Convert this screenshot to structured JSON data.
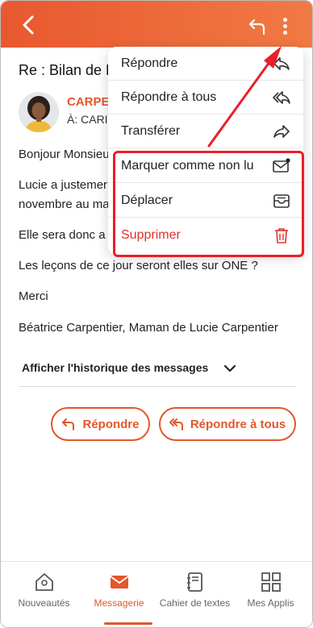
{
  "email": {
    "subject": "Re : Bilan de L",
    "sender_name": "CARPE",
    "sender_to": "À: CARI",
    "paragraphs": [
      "Bonjour Monsieu",
      "Lucie a justemer\nnovembre au ma",
      "Elle sera donc a",
      "Les leçons de ce jour seront elles sur ONE ?",
      "Merci",
      "Béatrice Carpentier, Maman de Lucie Carpentier"
    ],
    "history_label": "Afficher l'historique des messages"
  },
  "actions": {
    "reply": "Répondre",
    "reply_all": "Répondre à tous"
  },
  "menu": {
    "items": [
      {
        "label": "Répondre",
        "icon": "reply-icon"
      },
      {
        "label": "Répondre à tous",
        "icon": "reply-all-icon"
      },
      {
        "label": "Transférer",
        "icon": "forward-icon"
      },
      {
        "label": "Marquer comme non lu",
        "icon": "mail-unread-icon"
      },
      {
        "label": "Déplacer",
        "icon": "archive-tray-icon"
      },
      {
        "label": "Supprimer",
        "icon": "trash-icon"
      }
    ]
  },
  "bottom_nav": {
    "items": [
      {
        "label": "Nouveautés",
        "icon": "home-icon",
        "active": false
      },
      {
        "label": "Messagerie",
        "icon": "mail-icon",
        "active": true
      },
      {
        "label": "Cahier de textes",
        "icon": "notebook-icon",
        "active": false
      },
      {
        "label": "Mes Applis",
        "icon": "apps-grid-icon",
        "active": false
      }
    ]
  },
  "colors": {
    "brand": "#e2572b",
    "danger": "#e2312b",
    "highlight": "#e8202a"
  }
}
